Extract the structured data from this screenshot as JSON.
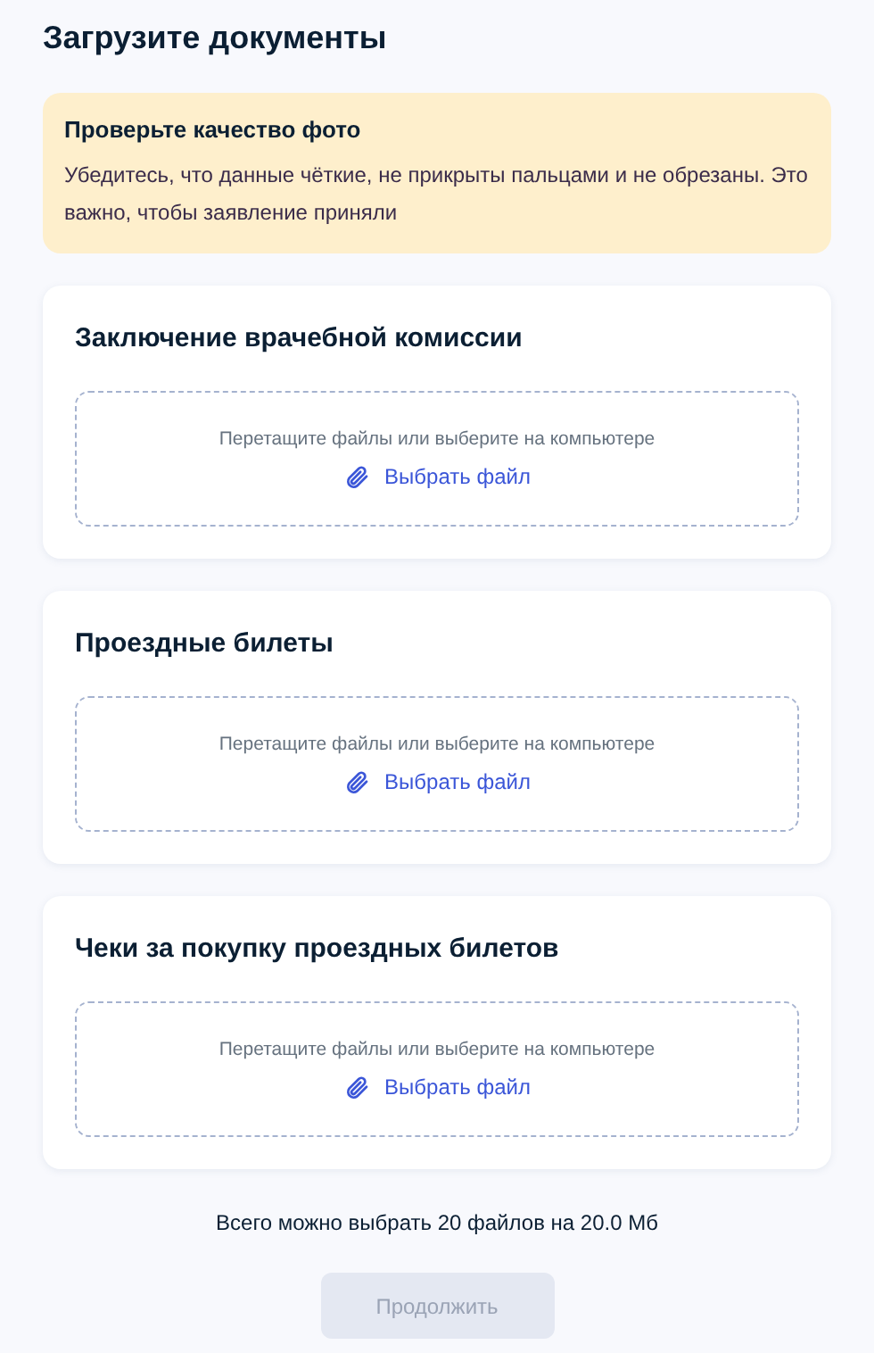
{
  "title": "Загрузите документы",
  "notice": {
    "title": "Проверьте качество фото",
    "text": "Убедитесь, что данные чёткие, не прикрыты пальцами и не обрезаны. Это важно, чтобы заявление приняли"
  },
  "uploads": [
    {
      "title": "Заключение врачебной комиссии",
      "hint": "Перетащите файлы или выберите на компьютере",
      "link": "Выбрать файл"
    },
    {
      "title": "Проездные билеты",
      "hint": "Перетащите файлы или выберите на компьютере",
      "link": "Выбрать файл"
    },
    {
      "title": "Чеки за покупку проездных билетов",
      "hint": "Перетащите файлы или выберите на компьютере",
      "link": "Выбрать файл"
    }
  ],
  "limit_text": "Всего можно выбрать 20 файлов на 20.0 Мб",
  "continue_button": {
    "label": "Продолжить",
    "disabled": true
  }
}
